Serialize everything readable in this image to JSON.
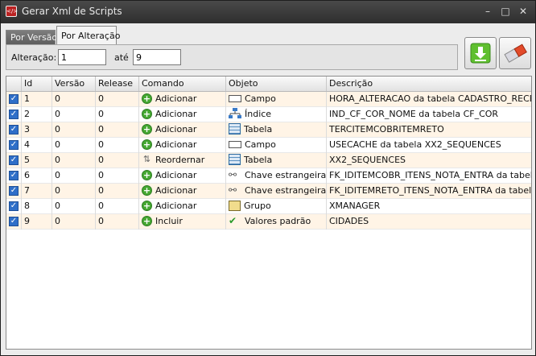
{
  "window": {
    "title": "Gerar Xml de Scripts",
    "icon": "xml-app-icon"
  },
  "controls": {
    "minimize": "minimize-icon",
    "maximize": "maximize-icon",
    "close": "close-icon"
  },
  "tabs": [
    {
      "label": "Por Versão",
      "active": false
    },
    {
      "label": "Por Alteração",
      "active": true
    }
  ],
  "filter": {
    "from_label": "Alteração:",
    "from_value": "1",
    "to_label": "até",
    "to_value": "9"
  },
  "actions": {
    "download_icon": "download-icon",
    "clear_icon": "eraser-icon"
  },
  "grid": {
    "columns": [
      "Id",
      "Versão",
      "Release",
      "Comando",
      "Objeto",
      "Descrição"
    ],
    "rows": [
      {
        "checked": true,
        "id": "1",
        "versao": "0",
        "release": "0",
        "comando": "Adicionar",
        "comando_icon": "add-icon",
        "objeto": "Campo",
        "objeto_icon": "field-icon",
        "descricao": "HORA_ALTERACAO da tabela CADASTRO_RECEITA"
      },
      {
        "checked": true,
        "id": "2",
        "versao": "0",
        "release": "0",
        "comando": "Adicionar",
        "comando_icon": "add-icon",
        "objeto": "Índice",
        "objeto_icon": "index-icon",
        "descricao": "IND_CF_COR_NOME da tabela CF_COR"
      },
      {
        "checked": true,
        "id": "3",
        "versao": "0",
        "release": "0",
        "comando": "Adicionar",
        "comando_icon": "add-icon",
        "objeto": "Tabela",
        "objeto_icon": "table-icon",
        "descricao": "TERCITEMCOBRITEMRETO"
      },
      {
        "checked": true,
        "id": "4",
        "versao": "0",
        "release": "0",
        "comando": "Adicionar",
        "comando_icon": "add-icon",
        "objeto": "Campo",
        "objeto_icon": "field-icon",
        "descricao": "USECACHE da tabela XX2_SEQUENCES"
      },
      {
        "checked": true,
        "id": "5",
        "versao": "0",
        "release": "0",
        "comando": "Reordernar",
        "comando_icon": "reorder-icon",
        "objeto": "Tabela",
        "objeto_icon": "table-icon",
        "descricao": "XX2_SEQUENCES"
      },
      {
        "checked": true,
        "id": "6",
        "versao": "0",
        "release": "0",
        "comando": "Adicionar",
        "comando_icon": "add-icon",
        "objeto": "Chave estrangeira",
        "objeto_icon": "foreign-key-icon",
        "descricao": "FK_IDITEMCOBR_ITENS_NOTA_ENTRA da tabela TE"
      },
      {
        "checked": true,
        "id": "7",
        "versao": "0",
        "release": "0",
        "comando": "Adicionar",
        "comando_icon": "add-icon",
        "objeto": "Chave estrangeira",
        "objeto_icon": "foreign-key-icon",
        "descricao": "FK_IDITEMRETO_ITENS_NOTA_ENTRA da tabela TE"
      },
      {
        "checked": true,
        "id": "8",
        "versao": "0",
        "release": "0",
        "comando": "Adicionar",
        "comando_icon": "add-icon",
        "objeto": "Grupo",
        "objeto_icon": "group-icon",
        "descricao": "XMANAGER"
      },
      {
        "checked": true,
        "id": "9",
        "versao": "0",
        "release": "0",
        "comando": "Incluir",
        "comando_icon": "add-icon",
        "objeto": "Valores padrão",
        "objeto_icon": "default-values-icon",
        "descricao": "CIDADES"
      }
    ]
  }
}
